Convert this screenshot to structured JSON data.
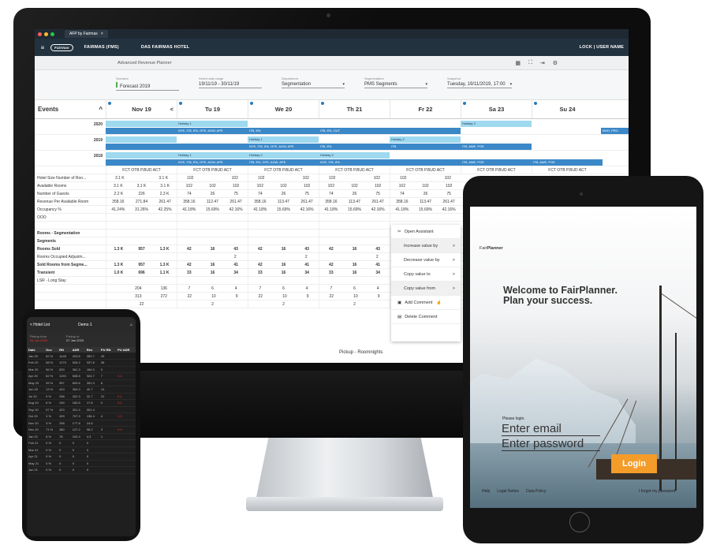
{
  "browser": {
    "tab_title": "AFP by Fairmas",
    "close": "×"
  },
  "app": {
    "logo": "Fairmas",
    "product": "FAIRMAS (FMS)",
    "hotel": "DAS FAIRMAS HOTEL",
    "user_links": "LOCK | USER NAME"
  },
  "subheader": {
    "title": "Advanced Revenue Planner"
  },
  "filters": [
    {
      "label": "Scenario",
      "value": "Forecast 2019"
    },
    {
      "label": "Select date range",
      "value": "19/11/19 - 30/11/19"
    },
    {
      "label": "Department",
      "value": "Segmentation"
    },
    {
      "label": "Segmentation",
      "value": "PMS Segments"
    },
    {
      "label": "Snapshot",
      "value": "Tuesday, 19/11/2019, 17:00"
    }
  ],
  "grid": {
    "events_label": "Events",
    "days": [
      "Nov 19",
      "Tu 19",
      "We 20",
      "Th 21",
      "Fr 22",
      "Sa 23",
      "Su 24"
    ],
    "years": [
      "2020",
      "2019",
      "2018"
    ],
    "bands": {
      "holiday1": "Holiday 1",
      "holiday2": "Holiday 2",
      "y2020_tu": "NYE, ITB, IFA, GFE, AGW, APE",
      "y2020_we": "ITB, IFA",
      "y2020_th": "ITB, IFA, OUT",
      "y2020_su": "NHO, PRO",
      "y2019_we": "NYE, ITB, IFA, GFE, AGW, APE",
      "y2019_th": "ITB, IFA",
      "y2019_fr": "ITB",
      "y2019_sa": "ITB, AWE, PGE",
      "y2018_tu": "NYE, ITB, IFA, GFE, AGW, APE",
      "y2018_we": "ITB, IFA, GFE, AGW, APE",
      "y2018_th": "NYE, ITB, IFA",
      "y2018_fr": "Holiday 2",
      "y2018_sa": "ITB, AWE, PGE",
      "y2018_su": "ITB, AWE, PGE"
    },
    "col_headers": "FCT   OTB   P.BUD   ACT",
    "rows": [
      {
        "label": "Hotel Size Number of Roo...",
        "cells": [
          [
            "3.1 K",
            "",
            "3.1 K"
          ],
          [
            "102",
            "",
            "102"
          ],
          [
            "102",
            "",
            "102"
          ],
          [
            "102",
            "",
            "102"
          ],
          [
            "102",
            "",
            "102"
          ]
        ]
      },
      {
        "label": "Available Rooms",
        "cells": [
          [
            "3.1 K",
            "3.1 K",
            "3.1 K"
          ],
          [
            "102",
            "102",
            "102"
          ],
          [
            "102",
            "102",
            "102"
          ],
          [
            "102",
            "102",
            "102"
          ],
          [
            "102",
            "102",
            "102"
          ]
        ]
      },
      {
        "label": "Number of Guests",
        "cells": [
          [
            "2.2 K",
            "226",
            "2.3 K"
          ],
          [
            "74",
            "26",
            "75"
          ],
          [
            "74",
            "26",
            "75"
          ],
          [
            "74",
            "26",
            "75"
          ],
          [
            "74",
            "26",
            "75"
          ]
        ]
      },
      {
        "label": "Revenue Per Available Room",
        "cells": [
          [
            "358.16",
            "271.84",
            "261.47"
          ],
          [
            "358.16",
            "112.47",
            "261.47"
          ],
          [
            "358.16",
            "113.47",
            "261.47"
          ],
          [
            "358.16",
            "113.47",
            "261.47"
          ],
          [
            "358.16",
            "113.47",
            "261.47"
          ]
        ]
      },
      {
        "label": "Occupancy %",
        "cells": [
          [
            "41.24%",
            "31.26%",
            "42.25%"
          ],
          [
            "41.18%",
            "15.69%",
            "42.16%"
          ],
          [
            "41.18%",
            "15.69%",
            "42.16%"
          ],
          [
            "41.18%",
            "15.69%",
            "42.16%"
          ],
          [
            "41.18%",
            "15.69%",
            "42.16%"
          ]
        ]
      },
      {
        "label": "OOO",
        "cells": [
          [
            "",
            "",
            ""
          ],
          [
            "",
            "",
            ""
          ],
          [
            "",
            "",
            ""
          ],
          [
            "",
            "",
            ""
          ],
          [
            "",
            "",
            ""
          ]
        ]
      },
      {
        "label": "",
        "cells": [
          [
            "",
            "",
            ""
          ],
          [
            "",
            "",
            ""
          ],
          [
            "",
            "",
            ""
          ],
          [
            "",
            "",
            ""
          ],
          [
            "",
            "",
            ""
          ]
        ]
      },
      {
        "label": "Rooms - Segmentation",
        "cells": [
          [
            "",
            "",
            ""
          ],
          [
            "",
            "",
            ""
          ],
          [
            "",
            "",
            ""
          ],
          [
            "",
            "",
            ""
          ],
          [
            "",
            "",
            ""
          ]
        ]
      },
      {
        "label": "Segments",
        "cells": [
          [
            "",
            "",
            ""
          ],
          [
            "",
            "",
            ""
          ],
          [
            "",
            "",
            ""
          ],
          [
            "",
            "",
            ""
          ],
          [
            "",
            "",
            ""
          ]
        ]
      },
      {
        "label": "Rooms Sold",
        "cells": [
          [
            "1.3 K",
            "957",
            "1.3 K"
          ],
          [
            "42",
            "16",
            "43"
          ],
          [
            "42",
            "16",
            "43"
          ],
          [
            "42",
            "16",
            "43"
          ],
          [
            "",
            "",
            ""
          ]
        ]
      },
      {
        "label": "Rooms Occupied Adjustm...",
        "cells": [
          [
            "",
            "",
            ""
          ],
          [
            "",
            "",
            "2"
          ],
          [
            "",
            "",
            "2"
          ],
          [
            "",
            "",
            "2"
          ],
          [
            "",
            "",
            ""
          ]
        ]
      },
      {
        "label": "Sold Rooms from Segme...",
        "cells": [
          [
            "1.3 K",
            "957",
            "1.3 K"
          ],
          [
            "42",
            "16",
            "41"
          ],
          [
            "42",
            "16",
            "41"
          ],
          [
            "42",
            "16",
            "41"
          ],
          [
            "",
            "",
            ""
          ]
        ]
      },
      {
        "label": "Transient",
        "cells": [
          [
            "1.0 K",
            "696",
            "1.1 K"
          ],
          [
            "33",
            "16",
            "34"
          ],
          [
            "33",
            "16",
            "34"
          ],
          [
            "33",
            "16",
            "34"
          ],
          [
            "",
            "",
            ""
          ]
        ]
      },
      {
        "label": "LSR - Long Stay",
        "cells": [
          [
            "",
            "",
            ""
          ],
          [
            "",
            "",
            ""
          ],
          [
            "",
            "",
            ""
          ],
          [
            "",
            "",
            ""
          ],
          [
            "",
            "",
            ""
          ]
        ]
      },
      {
        "label": "",
        "cells": [
          [
            "",
            "204",
            "136"
          ],
          [
            "7",
            "6",
            "4"
          ],
          [
            "7",
            "6",
            "4"
          ],
          [
            "7",
            "6",
            "4"
          ],
          [
            "",
            "",
            ""
          ]
        ]
      },
      {
        "label": "",
        "cells": [
          [
            "",
            "313",
            "272"
          ],
          [
            "22",
            "10",
            "9"
          ],
          [
            "22",
            "10",
            "9"
          ],
          [
            "22",
            "10",
            "9"
          ],
          [
            "",
            "",
            ""
          ]
        ]
      }
    ],
    "last_row": [
      "22",
      "2",
      "2",
      "2",
      "2"
    ],
    "pickup": "Pickup - Roomnights"
  },
  "context_menu": [
    {
      "label": "Open Assistant",
      "icon": "assistant-icon",
      "arrow": ""
    },
    {
      "label": "Increase value by",
      "icon": "",
      "arrow": ">"
    },
    {
      "label": "Decrease value by",
      "icon": "",
      "arrow": ">"
    },
    {
      "label": "Copy value to",
      "icon": "",
      "arrow": ">"
    },
    {
      "label": "Copy value from",
      "icon": "",
      "arrow": ">"
    },
    {
      "label": "Add Comment",
      "icon": "comment-icon",
      "arrow": ""
    },
    {
      "label": "Delete Comment",
      "icon": "delete-icon",
      "arrow": ""
    }
  ],
  "phone": {
    "back": "< Hotel List",
    "title": "Demo 1",
    "pickup_from_label": "Pickup from",
    "pickup_to_label": "Pickup to",
    "pickup_from": "06 Jan 2020",
    "pickup_to": "07 Jan 2020",
    "headers": [
      "Date",
      "Occ",
      "RN",
      "ADR",
      "Rev",
      "PU RN",
      "PU ADR"
    ],
    "rows": [
      [
        "Jan 20",
        "62 %",
        "1449",
        "423.6",
        "350.7",
        "45",
        ""
      ],
      [
        "Feb 20",
        "58 %",
        "1270",
        "526.2",
        "337.8",
        "36",
        ""
      ],
      [
        "Mar 20",
        "56 %",
        "833",
        "361.3",
        "184.0",
        "0",
        ""
      ],
      [
        "Apr 20",
        "62 %",
        "1193",
        "508.6",
        "324.7",
        "7",
        "0.1"
      ],
      [
        "May 20",
        "39 %",
        "957",
        "609.6",
        "261.0",
        "8",
        ""
      ],
      [
        "Jun 20",
        "13 %",
        "443",
        "353.3",
        "40.7",
        "14",
        ""
      ],
      [
        "Jul 20",
        "9 %",
        "338",
        "322.3",
        "32.7",
        "22",
        "0.1"
      ],
      [
        "Aug 20",
        "6 %",
        "190",
        "183.5",
        "17.8",
        "0",
        "0.1"
      ],
      [
        "Sep 20",
        "57 %",
        "423",
        "321.4",
        "301.4",
        "",
        ""
      ],
      [
        "Oct 20",
        "3 %",
        "499",
        "707.9",
        "138.4",
        "4",
        "1.2"
      ],
      [
        "Nov 20",
        "3 %",
        "258",
        "177.8",
        "24.6",
        "",
        ""
      ],
      [
        "Dec 20",
        "71 %",
        "380",
        "127.2",
        "98.2",
        "3",
        "0.4"
      ],
      [
        "Jan 21",
        "8 %",
        "78",
        "102.4",
        "4.3",
        "1",
        ""
      ],
      [
        "Feb 21",
        "0 %",
        "0",
        "0",
        "0",
        "",
        ""
      ],
      [
        "Mar 21",
        "0 %",
        "0",
        "0",
        "0",
        "",
        ""
      ],
      [
        "Apr 21",
        "0 %",
        "0",
        "0",
        "0",
        "",
        ""
      ],
      [
        "May 21",
        "0 %",
        "0",
        "0",
        "0",
        "",
        ""
      ],
      [
        "Jun 21",
        "0 %",
        "0",
        "0",
        "0",
        "",
        ""
      ]
    ]
  },
  "tablet": {
    "logo_pre": "Fair",
    "logo_bold": "Planner",
    "welcome_line1": "Welcome to FairPlanner.",
    "welcome_line2": "Plan your success.",
    "please_login": "Please login.",
    "email_placeholder": "Enter email",
    "password_placeholder": "Enter password",
    "login": "Login",
    "links": [
      "Help",
      "Legal Notice",
      "Data Policy"
    ],
    "forgot": "I forgot my password"
  },
  "colors": {
    "accent": "#3b88c8",
    "holiday": "#9ed9ef",
    "login": "#f39c2a",
    "appbar": "#23323f"
  }
}
